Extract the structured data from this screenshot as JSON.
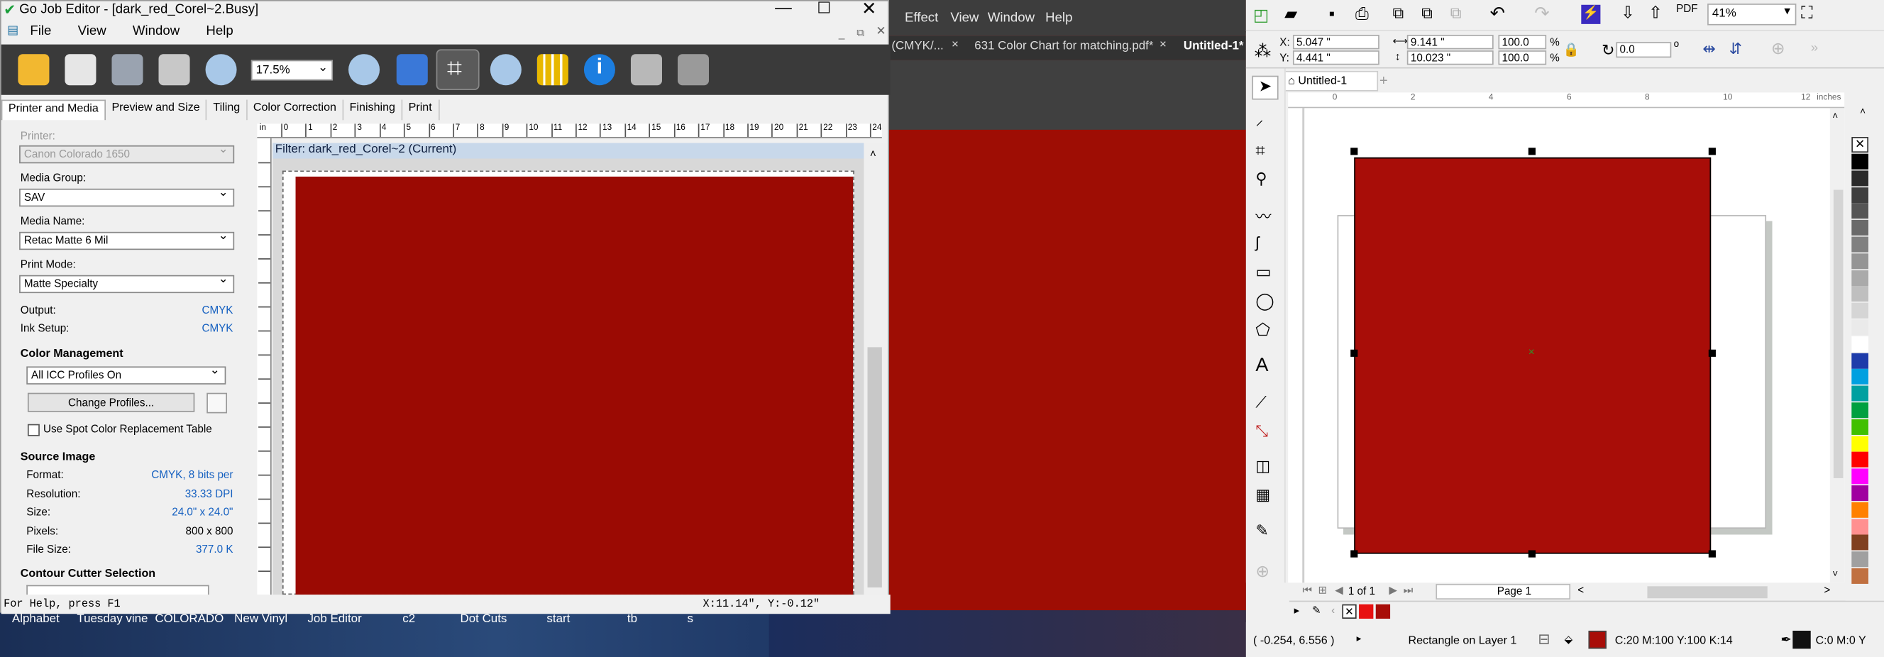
{
  "go_job_editor": {
    "title": "Go Job Editor - [dark_red_Corel~2.Busy]",
    "menu": [
      "File",
      "View",
      "Window",
      "Help"
    ],
    "zoom": "17.5%",
    "tabs": [
      "Printer and Media",
      "Preview and Size",
      "Tiling",
      "Color Correction",
      "Finishing",
      "Print"
    ],
    "printer_label": "Printer:",
    "printer_value": "Canon Colorado 1650",
    "media_group_label": "Media Group:",
    "media_group_value": "SAV",
    "media_name_label": "Media Name:",
    "media_name_value": "Retac Matte 6 Mil",
    "print_mode_label": "Print Mode:",
    "print_mode_value": "Matte Specialty",
    "output_label": "Output:",
    "output_value": "CMYK",
    "ink_setup_label": "Ink Setup:",
    "ink_setup_value": "CMYK",
    "color_mgmt_header": "Color Management",
    "icc_value": "All ICC Profiles On",
    "change_profiles": "Change Profiles...",
    "spot_color_label": "Use Spot Color Replacement Table",
    "source_header": "Source Image",
    "format_label": "Format:",
    "format_value": "CMYK, 8 bits per",
    "resolution_label": "Resolution:",
    "resolution_value": "33.33 DPI",
    "size_label": "Size:",
    "size_value": "24.0\" x 24.0\"",
    "pixels_label": "Pixels:",
    "pixels_value": "800 x 800",
    "filesize_label": "File Size:",
    "filesize_value": "377.0 K",
    "contour_header": "Contour Cutter Selection",
    "filter_label": "Filter: dark_red_Corel~2 (Current)",
    "ruler_unit": "in",
    "ruler_ticks": [
      "0",
      "1",
      "2",
      "3",
      "4",
      "5",
      "6",
      "7",
      "8",
      "9",
      "10",
      "11",
      "12",
      "13",
      "14",
      "15",
      "16",
      "17",
      "18",
      "19",
      "20",
      "21",
      "22",
      "23",
      "24"
    ],
    "status_help": "For Help, press F1",
    "status_coords": "X:11.14\", Y:-0.12\""
  },
  "taskbar": [
    "Alphabet",
    "Tuesday vine",
    "COLORADO",
    "New Vinyl",
    "Job Editor",
    "c2",
    "Dot Cuts",
    "start",
    "tb",
    "s"
  ],
  "dark_app": {
    "menu": [
      "Effect",
      "View",
      "Window",
      "Help"
    ],
    "tabs": [
      "(CMYK/...",
      "631 Color Chart for matching.pdf*",
      "Untitled-1*"
    ]
  },
  "corel": {
    "zoom": "41%",
    "x": "5.047 \"",
    "y": "4.441 \"",
    "w": "9.141 \"",
    "h": "10.023 \"",
    "sx": "100.0",
    "sy": "100.0",
    "pct": "%",
    "rotation": "0.0",
    "doc_tab": "Untitled-1",
    "ruler_unit": "inches",
    "ruler_ticks": [
      "0",
      "2",
      "4",
      "6",
      "8",
      "10",
      "12"
    ],
    "page_counter": "1 of 1",
    "page_tab": "Page 1",
    "cursor_pos": "( -0.254, 6.556 )",
    "object_info": "Rectangle on Layer 1",
    "fill_info": "C:20 M:100 Y:100 K:14",
    "outline_info": "C:0 M:0 Y",
    "fill_color": "#a80d08",
    "palette": [
      "#000000",
      "#2a2a2a",
      "#3f3f3f",
      "#555555",
      "#6a6a6a",
      "#808080",
      "#959595",
      "#aaaaaa",
      "#bfbfbf",
      "#d5d5d5",
      "#eaeaea",
      "#ffffff",
      "#1e3caa",
      "#00a0e0",
      "#00a0a0",
      "#00a040",
      "#40c000",
      "#ffff00",
      "#ff0000",
      "#ff00ff",
      "#a000a0",
      "#ff8000",
      "#ff9090",
      "#804020",
      "#a0a0a0",
      "#c07040"
    ]
  }
}
